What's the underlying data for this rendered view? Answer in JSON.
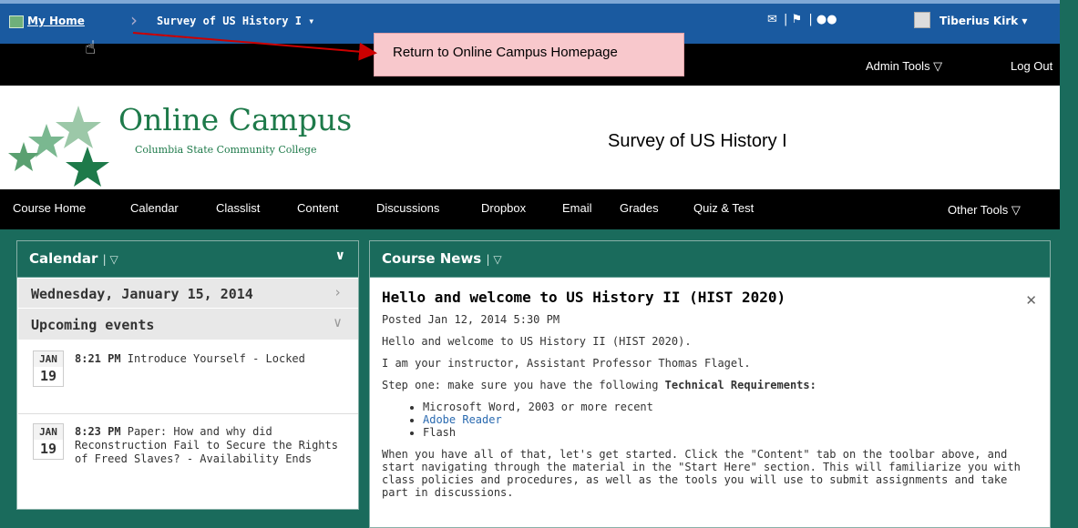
{
  "minibar": {
    "home": "My Home",
    "course": "Survey of US History I ▾",
    "user": "Tiberius Kirk ▾",
    "icons": [
      "mail-icon",
      "alerts-icon",
      "chat-icon"
    ]
  },
  "callout": "Return to Online Campus Homepage",
  "adminbar": {
    "admin_tools": "Admin Tools ▽",
    "logout": "Log Out"
  },
  "header": {
    "brand": "Online Campus",
    "brand_sub": "Columbia State Community College",
    "course_title": "Survey of US History I"
  },
  "nav": {
    "items": [
      "Course Home",
      "Calendar",
      "Classlist",
      "Content",
      "Discussions",
      "Dropbox",
      "Email",
      "Grades",
      "Quiz & Test"
    ],
    "other": "Other Tools ▽"
  },
  "calendar": {
    "title": "Calendar",
    "date": "Wednesday, January 15, 2014",
    "upcoming": "Upcoming events",
    "events": [
      {
        "month": "JAN",
        "day": "19",
        "time": "8:21 PM",
        "text": " Introduce Yourself - Locked"
      },
      {
        "month": "JAN",
        "day": "19",
        "time": "8:23 PM",
        "text": " Paper: How and why did Reconstruction Fail to Secure the Rights of Freed Slaves? - Availability Ends"
      }
    ]
  },
  "news": {
    "title": "Course News",
    "post_title": "Hello and welcome to US History II (HIST 2020)",
    "posted": "Posted Jan 12, 2014 5:30 PM",
    "p1": "Hello and welcome to US History II (HIST 2020).",
    "p2": "I am your instructor, Assistant Professor Thomas Flagel.",
    "p3_pre": "Step one: make sure you have the following ",
    "p3_bold": "Technical Requirements:",
    "reqs": [
      "Microsoft Word, 2003 or more recent",
      "Adobe Reader",
      "Flash"
    ],
    "p4": "When you have all of that, let's get started. Click the \"Content\" tab on the toolbar above, and start navigating through the material in the \"Start Here\" section. This will familiarize you with class policies and procedures, as well as the tools you will use to submit assignments and take part in discussions."
  }
}
